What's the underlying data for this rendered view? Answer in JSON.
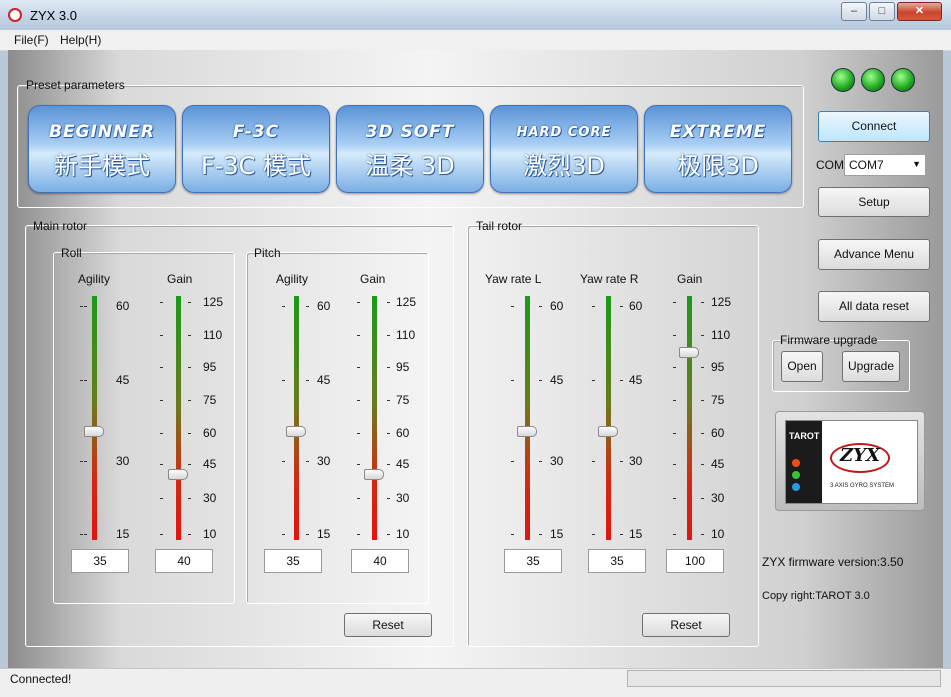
{
  "window": {
    "title": "ZYX 3.0",
    "min": "–",
    "max": "□",
    "close": "✕"
  },
  "menu": [
    "File(F)",
    "Help(H)"
  ],
  "preset": {
    "label": "Preset parameters",
    "buttons": [
      {
        "en": "BEGINNER",
        "cn": "新手模式"
      },
      {
        "en": "F-3C",
        "cn": "F-3C 模式"
      },
      {
        "en": "3D SOFT",
        "cn": "温柔 3D"
      },
      {
        "en": "HARD CORE",
        "cn": "激烈3D"
      },
      {
        "en": "EXTREME",
        "cn": "极限3D"
      }
    ]
  },
  "main_rotor": {
    "label": "Main rotor",
    "roll": {
      "label": "Roll",
      "agility_label": "Agility",
      "gain_label": "Gain",
      "agility_value": "35",
      "gain_value": "40"
    },
    "pitch": {
      "label": "Pitch",
      "agility_label": "Agility",
      "gain_label": "Gain",
      "agility_value": "35",
      "gain_value": "40"
    },
    "reset": "Reset"
  },
  "tail_rotor": {
    "label": "Tail rotor",
    "yaw_l_label": "Yaw rate L",
    "yaw_r_label": "Yaw rate R",
    "gain_label": "Gain",
    "yaw_l_value": "35",
    "yaw_r_value": "35",
    "gain_value": "100",
    "reset": "Reset"
  },
  "scales": {
    "agility": [
      "60",
      "45",
      "30",
      "15"
    ],
    "gain": [
      "125",
      "110",
      "95",
      "75",
      "60",
      "45",
      "30",
      "10"
    ]
  },
  "side": {
    "connect": "Connect",
    "com_label": "COM",
    "com_value": "COM7",
    "setup": "Setup",
    "advance": "Advance Menu",
    "all_reset": "All data reset",
    "firmware_label": "Firmware upgrade",
    "open": "Open",
    "upgrade": "Upgrade",
    "fw_version": "ZYX firmware version:3.50",
    "copyright": "Copy right:TAROT 3.0"
  },
  "logo": {
    "brand": "TAROT",
    "product": "ZYX",
    "caption": "3 AXIS GYRO SYSTEM"
  },
  "status": {
    "text": "Connected!"
  },
  "colors": {
    "led": "#22c022",
    "bar_top": "#1a9a1a",
    "bar_bottom": "#e0150f",
    "preset_blue": "#7aaee4"
  }
}
